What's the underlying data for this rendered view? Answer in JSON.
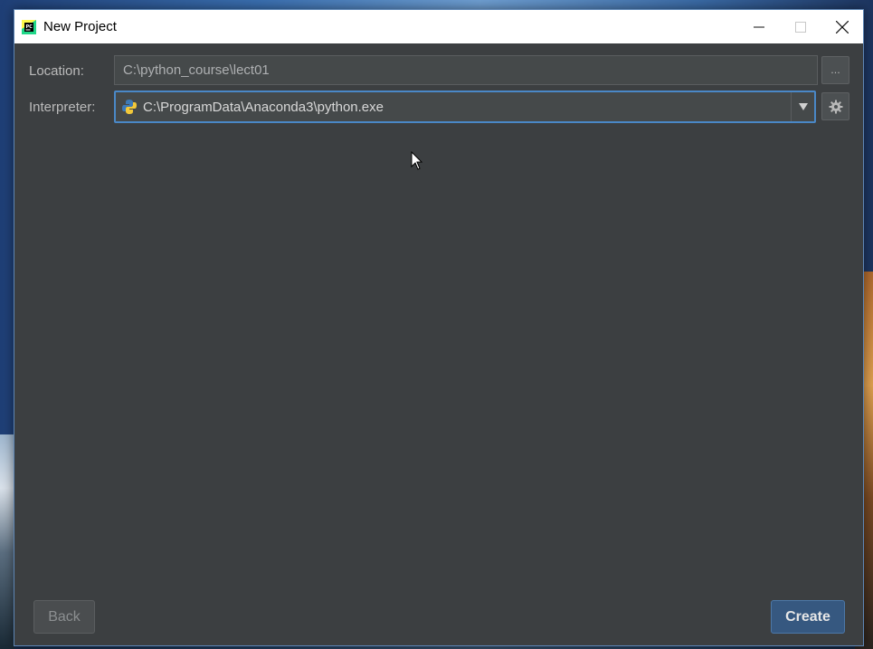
{
  "window": {
    "title": "New Project"
  },
  "form": {
    "location": {
      "label": "Location:",
      "value": "C:\\python_course\\lect01",
      "browse_label": "..."
    },
    "interpreter": {
      "label": "Interpreter:",
      "value": "C:\\ProgramData\\Anaconda3\\python.exe"
    }
  },
  "footer": {
    "back_label": "Back",
    "create_label": "Create"
  },
  "icons": {
    "app": "pycharm-icon",
    "interpreter": "python-icon",
    "settings": "gear-icon",
    "dropdown": "triangle-down-icon"
  },
  "colors": {
    "dialog_bg": "#3c3f41",
    "field_bg": "#45494a",
    "focus_border": "#4a88c7",
    "create_button": "#365880"
  }
}
